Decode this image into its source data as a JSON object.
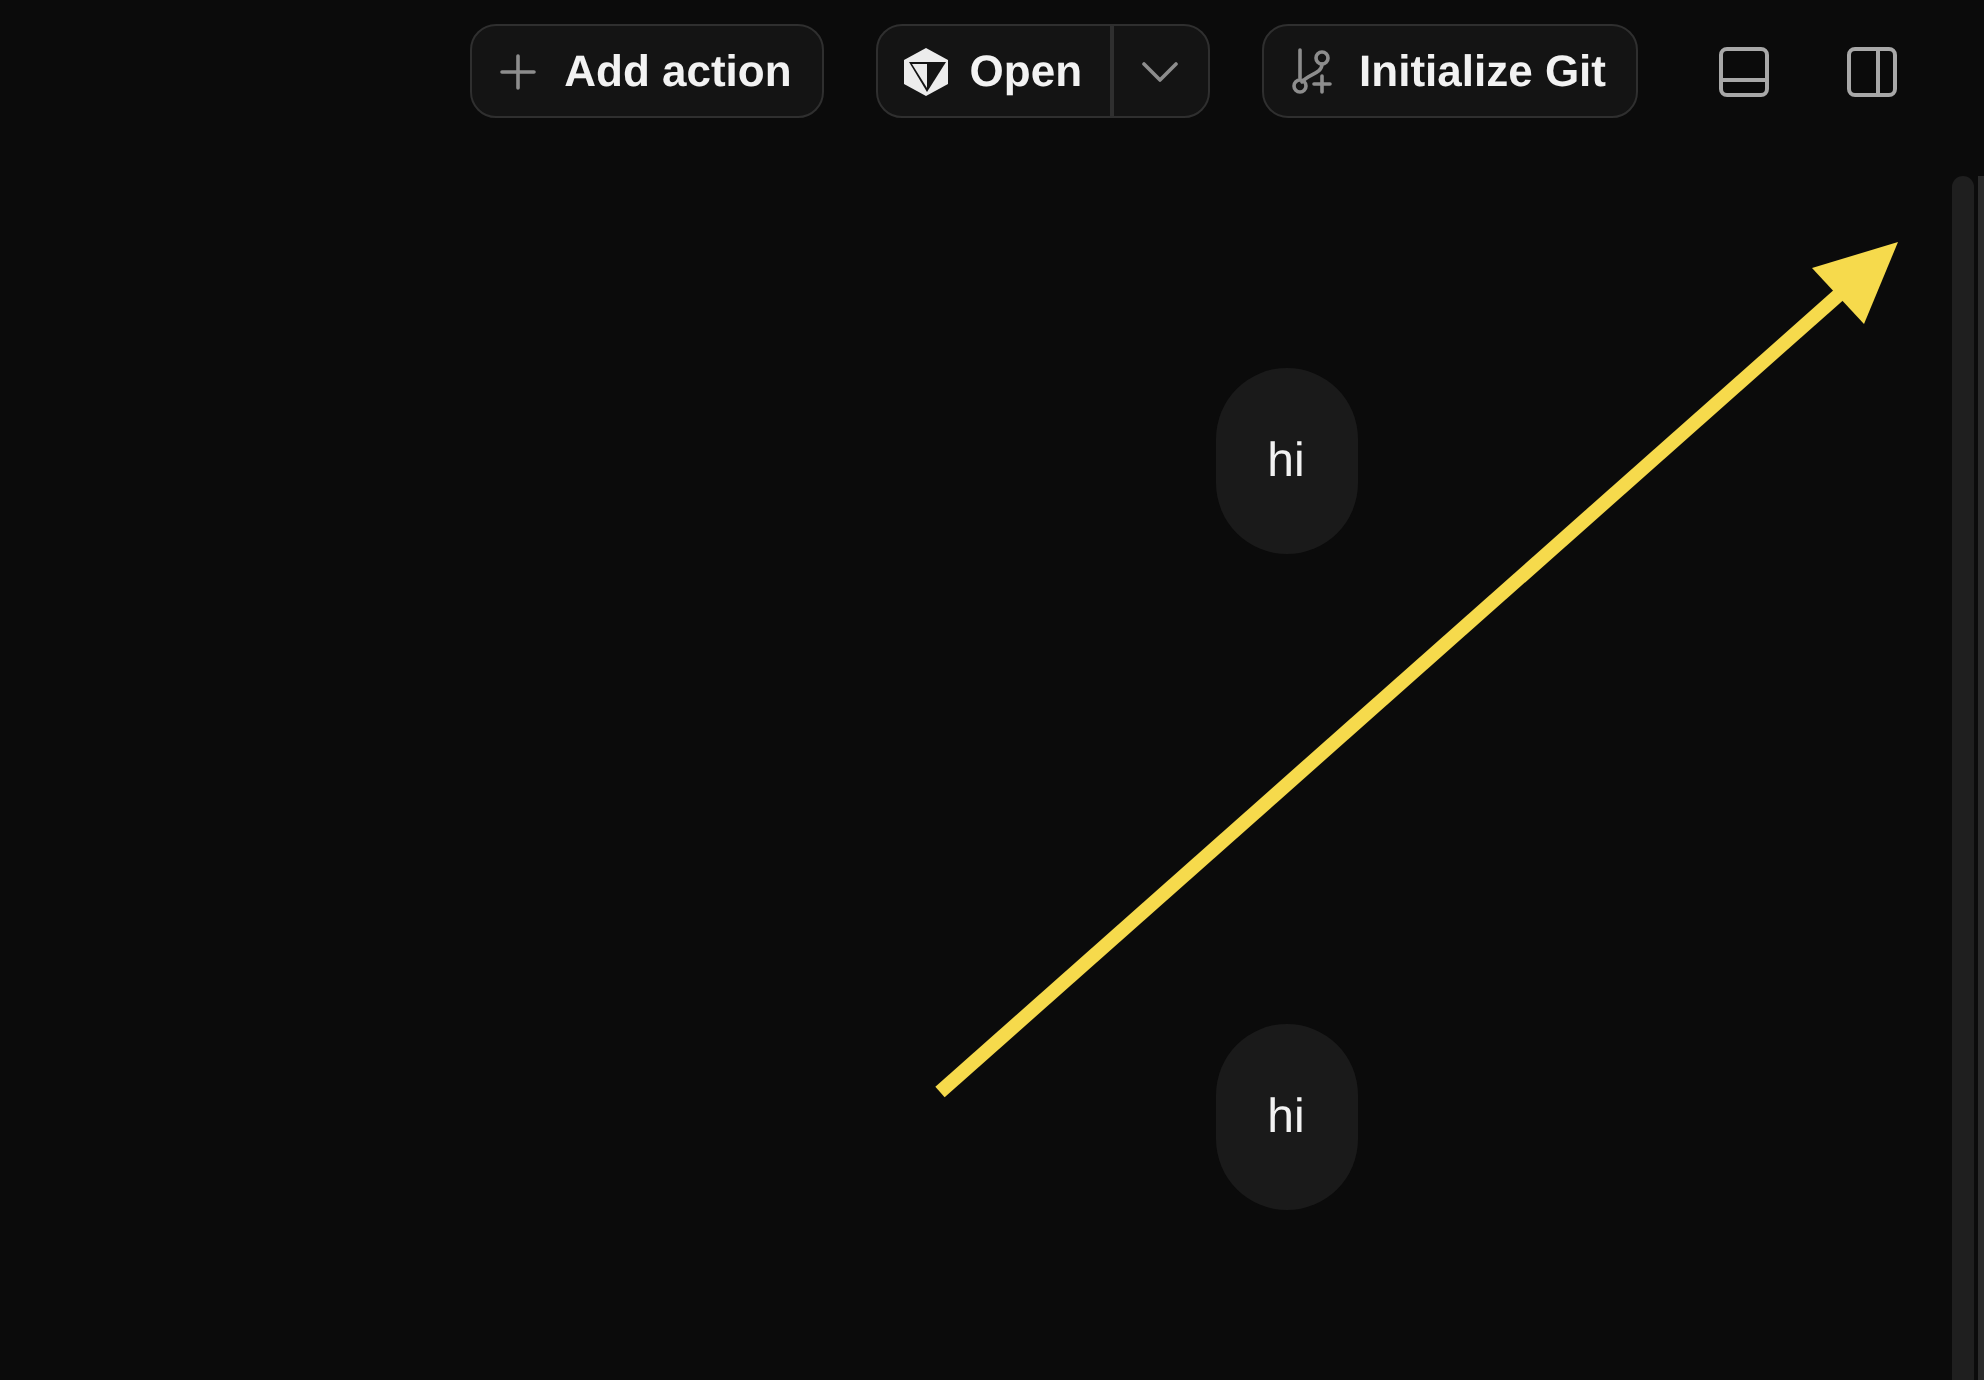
{
  "toolbar": {
    "add_action": {
      "label": "Add action"
    },
    "open": {
      "label": "Open"
    },
    "initialize_git": {
      "label": "Initialize Git"
    }
  },
  "messages": [
    {
      "text": "hi"
    },
    {
      "text": "hi"
    }
  ]
}
